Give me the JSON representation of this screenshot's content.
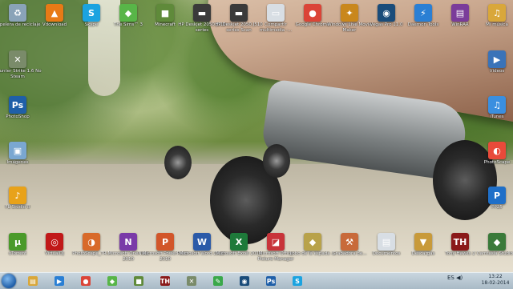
{
  "desktop": {
    "icons": [
      {
        "name": "recycle-bin-icon",
        "label": "Papelera de reciclaje",
        "glyph": "♻",
        "color": "#8aa3b8"
      },
      {
        "name": "vlc-icon",
        "label": "Vdownload",
        "glyph": "▲",
        "color": "#e87a16"
      },
      {
        "name": "skype-icon",
        "label": "Skype",
        "glyph": "S",
        "color": "#1ba3e0"
      },
      {
        "name": "sims3-icon",
        "label": "The Sims™ 3",
        "glyph": "◆",
        "color": "#58b548"
      },
      {
        "name": "minecraft-icon",
        "label": "Minecraft",
        "glyph": "■",
        "color": "#5f8a3a"
      },
      {
        "name": "hp-deskjet-icon",
        "label": "HP Deskjet 2050 J510 series",
        "glyph": "▬",
        "color": "#3a3a3a"
      },
      {
        "name": "hp-deskjet-scan-icon",
        "label": "HP Deskjet 2050 J510 series Scan",
        "glyph": "▬",
        "color": "#3a3a3a"
      },
      {
        "name": "compartir-icon",
        "label": "Compartir multimedia -...",
        "glyph": "▭",
        "color": "#d8dee4"
      },
      {
        "name": "chrome-icon",
        "label": "Google Chrome",
        "glyph": "●",
        "color": "#db4437"
      },
      {
        "name": "movie-maker-icon",
        "label": "Windows Live Movie Maker",
        "glyph": "✦",
        "color": "#c9871c"
      },
      {
        "name": "vegas-icon",
        "label": "Vegas Pro 11.0",
        "glyph": "◉",
        "color": "#1a4c7a"
      },
      {
        "name": "daemon-icon",
        "label": "Daemon Tools",
        "glyph": "⚡",
        "color": "#2a7fd4"
      },
      {
        "name": "winrar-icon",
        "label": "WinRAR",
        "glyph": "▤",
        "color": "#7a3c9a"
      },
      {
        "name": "mi-musica-icon",
        "label": "Mi música",
        "glyph": "♫",
        "color": "#d9a73a"
      },
      {
        "name": "counter-strike-icon",
        "label": "Counter Strike 1.6 No Steam",
        "glyph": "✕",
        "color": "#7a8b6a"
      },
      {
        "name": "photoshop-icon",
        "label": "PhotoShop",
        "glyph": "Ps",
        "color": "#1f5fa8"
      },
      {
        "name": "imagenes-icon",
        "label": "Imágenes",
        "glyph": "▣",
        "color": "#7aa7d1"
      },
      {
        "name": "fl-studio-icon",
        "label": "FL Studio 8",
        "glyph": "♪",
        "color": "#e8a21a"
      },
      {
        "name": "videos-icon",
        "label": "Vídeos",
        "glyph": "▶",
        "color": "#3a73b8"
      },
      {
        "name": "itunes-icon",
        "label": "iTunes",
        "glyph": "♫",
        "color": "#3a8fe0"
      },
      {
        "name": "photoscape-icon",
        "label": "PhotoScape",
        "glyph": "◐",
        "color": "#e84a3a"
      },
      {
        "name": "ps2-emulator-icon",
        "label": "PP25",
        "glyph": "P",
        "color": "#1f6fc8"
      },
      {
        "name": "utorrent-icon",
        "label": "uTorrent",
        "glyph": "μ",
        "color": "#4a9a2a"
      },
      {
        "name": "virtual-dj-icon",
        "label": "VirtualDJ",
        "glyph": "◎",
        "color": "#c11919"
      },
      {
        "name": "photoscape2-icon",
        "label": "PhotoScape_TR...",
        "glyph": "◑",
        "color": "#d86a2a"
      },
      {
        "name": "onenote-icon",
        "label": "Microsoft OneNote 2010",
        "glyph": "N",
        "color": "#7a3aa8"
      },
      {
        "name": "powerpoint-icon",
        "label": "Microsoft PowerPoint 2010",
        "glyph": "P",
        "color": "#d2562a"
      },
      {
        "name": "word-icon",
        "label": "Microsoft Word 2010",
        "glyph": "W",
        "color": "#2b5aa8"
      },
      {
        "name": "excel-icon",
        "label": "Microsoft Excel 2010",
        "glyph": "X",
        "color": "#1e7a3a"
      },
      {
        "name": "picture-manager-icon",
        "label": "Microsoft Office Picture Manager",
        "glyph": "◪",
        "color": "#c8343a"
      },
      {
        "name": "lobos-icon",
        "label": "Lobo de la espada ...",
        "glyph": "◆",
        "color": "#b8a24a"
      },
      {
        "name": "ascii-icon",
        "label": "Grabadora de...",
        "glyph": "⚒",
        "color": "#c86a3a"
      },
      {
        "name": "documentos-icon",
        "label": "Documentos",
        "glyph": "▤",
        "color": "#d8dee4"
      },
      {
        "name": "descargas-icon",
        "label": "Descargas",
        "glyph": "▼",
        "color": "#c89a3a"
      },
      {
        "name": "tony-hawk-icon",
        "label": "Tony Hawks 2",
        "glyph": "TH",
        "color": "#8a1a1a"
      },
      {
        "name": "camtasia-icon",
        "label": "Camtasia Studio 8",
        "glyph": "◆",
        "color": "#3a7a3a"
      }
    ]
  },
  "taskbar": {
    "buttons": [
      {
        "name": "taskbar-explorer",
        "glyph": "▤",
        "color": "#d9a73a"
      },
      {
        "name": "taskbar-media-player",
        "glyph": "▶",
        "color": "#2a7fd4"
      },
      {
        "name": "taskbar-chrome",
        "glyph": "●",
        "color": "#db4437"
      },
      {
        "name": "taskbar-sims",
        "glyph": "◆",
        "color": "#58b548"
      },
      {
        "name": "taskbar-minecraft",
        "glyph": "■",
        "color": "#5f8a3a"
      },
      {
        "name": "taskbar-tony-hawk",
        "glyph": "TH",
        "color": "#8a1a1a"
      },
      {
        "name": "taskbar-cs",
        "glyph": "✕",
        "color": "#7a8b6a"
      },
      {
        "name": "taskbar-paint",
        "glyph": "✎",
        "color": "#3aa84a"
      },
      {
        "name": "taskbar-vegas",
        "glyph": "◉",
        "color": "#1a4c7a"
      },
      {
        "name": "taskbar-photoshop",
        "glyph": "Ps",
        "color": "#1f5fa8"
      },
      {
        "name": "taskbar-skype",
        "glyph": "S",
        "color": "#1ba3e0"
      }
    ],
    "tray_lang": "ES",
    "clock_time": "13:22",
    "clock_date": "18-02-2014"
  }
}
